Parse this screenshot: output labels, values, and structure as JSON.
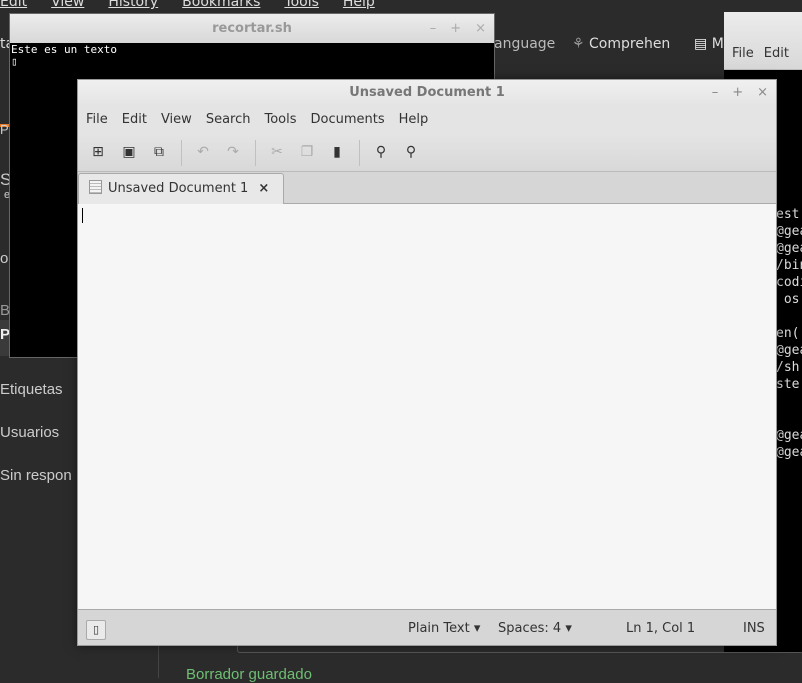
{
  "browser": {
    "menu": [
      "Edit",
      "View",
      "History",
      "Bookmarks",
      "Tools",
      "Help"
    ],
    "bookmarks": [
      "ta",
      "anguage",
      "Comprehen",
      "M"
    ],
    "sidebar": [
      "Pr",
      "S",
      "e",
      "o",
      "BL",
      "P",
      "Etiquetas",
      "Usuarios",
      "Sin respon"
    ],
    "draft_status": "Borrador guardado"
  },
  "terminal_left": {
    "title": "recortar.sh",
    "controls": [
      "–",
      "+",
      "×"
    ],
    "content": "Este es un texto\n▯"
  },
  "terminal_right": {
    "menu": [
      "File",
      "Edit"
    ],
    "lines": [
      "est",
      "@gea",
      "@gea",
      "/bin",
      "codi",
      " os",
      "",
      "en(",
      "@gea",
      "/sh",
      "ste",
      "",
      "",
      "@gea",
      "@gea"
    ]
  },
  "gedit": {
    "title": "Unsaved Document 1",
    "controls": [
      "–",
      "+",
      "×"
    ],
    "menu": [
      "File",
      "Edit",
      "View",
      "Search",
      "Tools",
      "Documents",
      "Help"
    ],
    "toolbar": [
      "new-document",
      "open",
      "save",
      "undo",
      "redo",
      "cut",
      "copy",
      "paste",
      "find",
      "find-replace"
    ],
    "tab_label": "Unsaved Document 1",
    "tab_close": "×",
    "content": "",
    "status": {
      "language": "Plain Text",
      "indent": "Spaces: 4",
      "position": "Ln 1, Col 1",
      "mode": "INS"
    }
  }
}
